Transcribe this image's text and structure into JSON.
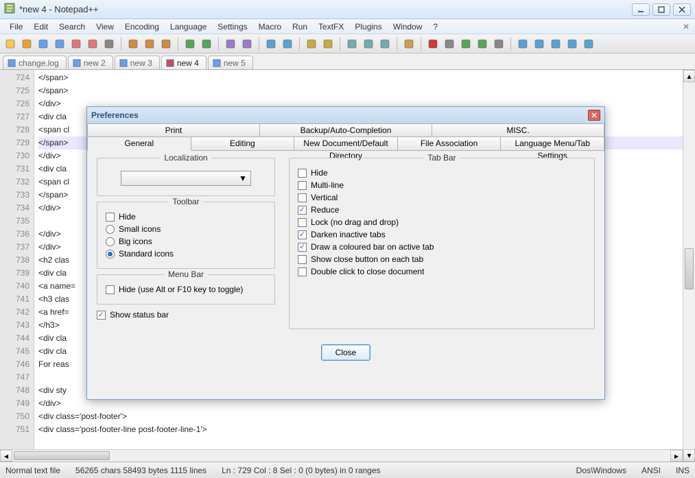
{
  "window": {
    "title": "*new 4 - Notepad++"
  },
  "menubar": {
    "items": [
      "File",
      "Edit",
      "Search",
      "View",
      "Encoding",
      "Language",
      "Settings",
      "Macro",
      "Run",
      "TextFX",
      "Plugins",
      "Window",
      "?"
    ]
  },
  "tabs": [
    {
      "label": "change.log",
      "active": false
    },
    {
      "label": "new  2",
      "active": false
    },
    {
      "label": "new  3",
      "active": false
    },
    {
      "label": "new  4",
      "active": true
    },
    {
      "label": "new  5",
      "active": false
    }
  ],
  "editor": {
    "first_line_number": 724,
    "lines": [
      "</span>",
      "</span>",
      "</div>",
      "<div cla",
      "<span cl",
      "</span>",
      "</div>",
      "<div cla",
      "<span cl",
      "</span>",
      "</div>",
      "",
      "</div>",
      "</div>",
      "<h2 clas",
      "<div cla",
      "<a name=",
      "<h3 clas",
      "<a href=",
      "</h3>",
      "<div cla",
      "<div cla",
      "For reas                                                                                                 ?<br /><br /",
      "",
      "<div sty",
      "</div>",
      "<div class='post-footer'>",
      "<div class='post-footer-line post-footer-line-1'>"
    ],
    "highlight_line_index": 5
  },
  "statusbar": {
    "filetype": "Normal text file",
    "stats": "56265 chars   58493 bytes   1115 lines",
    "pos": "Ln : 729    Col : 8    Sel : 0 (0 bytes) in 0 ranges",
    "eol": "Dos\\Windows",
    "encoding": "ANSI",
    "mode": "INS"
  },
  "dialog": {
    "title": "Preferences",
    "tab_row_top": [
      "Print",
      "Backup/Auto-Completion",
      "MISC."
    ],
    "tab_row_bottom": [
      "General",
      "Editing",
      "New Document/Default Directory",
      "File Association",
      "Language Menu/Tab Settings"
    ],
    "active_tab": "General",
    "localization": {
      "legend": "Localization",
      "selected": ""
    },
    "toolbar_group": {
      "legend": "Toolbar",
      "hide_label": "Hide",
      "small_label": "Small icons",
      "big_label": "Big icons",
      "std_label": "Standard icons",
      "hide_checked": false,
      "selected_radio": "std"
    },
    "menubar_group": {
      "legend": "Menu Bar",
      "hide_label": "Hide (use Alt or F10 key to toggle)",
      "hide_checked": false
    },
    "show_statusbar": {
      "label": "Show status bar",
      "checked": true
    },
    "tabbar_group": {
      "legend": "Tab Bar",
      "options": [
        {
          "label": "Hide",
          "checked": false
        },
        {
          "label": "Multi-line",
          "checked": false
        },
        {
          "label": "Vertical",
          "checked": false
        },
        {
          "label": "Reduce",
          "checked": true
        },
        {
          "label": "Lock (no drag and drop)",
          "checked": false
        },
        {
          "label": "Darken inactive tabs",
          "checked": true
        },
        {
          "label": "Draw a coloured bar on active tab",
          "checked": true
        },
        {
          "label": "Show close button on each tab",
          "checked": false
        },
        {
          "label": "Double click to close document",
          "checked": false
        }
      ]
    },
    "close_button": "Close"
  },
  "toolbar_icons": [
    "new-file",
    "open-file",
    "save",
    "save-all",
    "close",
    "close-all",
    "print",
    "sep",
    "cut",
    "copy",
    "paste",
    "sep",
    "undo",
    "redo",
    "sep",
    "find",
    "replace",
    "sep",
    "zoom-in",
    "zoom-out",
    "sep",
    "sync-v",
    "sync-h",
    "sep",
    "wrap",
    "all-chars",
    "indent",
    "sep",
    "folder",
    "sep",
    "record",
    "stop",
    "play",
    "play-multi",
    "save-macro",
    "sep",
    "toggle-1",
    "toggle-2",
    "toggle-3",
    "toggle-4",
    "toggle-5"
  ]
}
